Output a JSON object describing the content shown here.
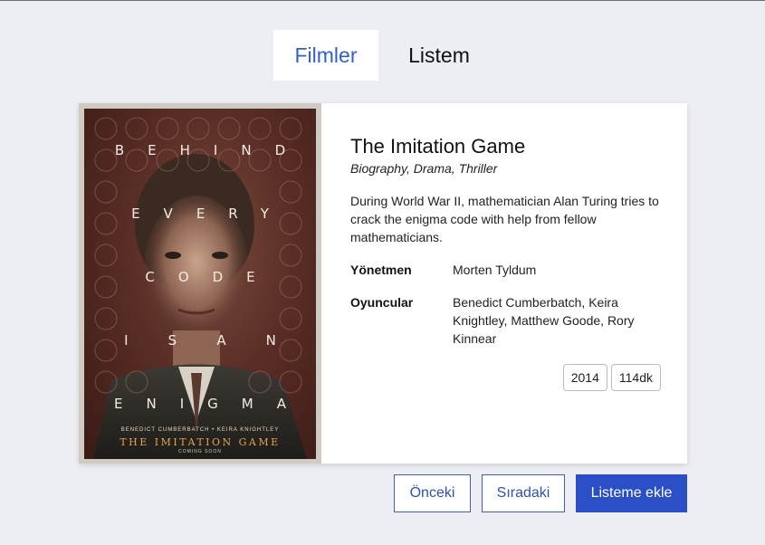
{
  "tabs": [
    {
      "label": "Filmler",
      "active": true
    },
    {
      "label": "Listem",
      "active": false
    }
  ],
  "movie": {
    "title": "The Imitation Game",
    "genres": "Biography, Drama, Thriller",
    "description": "During World War II, mathematician Alan Turing tries to crack the enigma code with help from fellow mathematicians.",
    "director_label": "Yönetmen",
    "director": "Morten Tyldum",
    "cast_label": "Oyuncular",
    "cast": "Benedict Cumberbatch, Keira Knightley, Matthew Goode, Rory Kinnear",
    "year": "2014",
    "duration": "114dk"
  },
  "poster": {
    "lines": [
      "BEHIND",
      "EVERY",
      "CODE",
      "ISAN",
      "ENIGMA"
    ],
    "credits": "BENEDICT CUMBERBATCH • KEIRA KNIGHTLEY",
    "title": "THE IMITATION GAME",
    "coming": "COMING SOON"
  },
  "buttons": {
    "previous": "Önceki",
    "next": "Sıradaki",
    "add": "Listeme ekle"
  },
  "colors": {
    "accent": "#2b4fc7",
    "background": "#eceef3"
  }
}
